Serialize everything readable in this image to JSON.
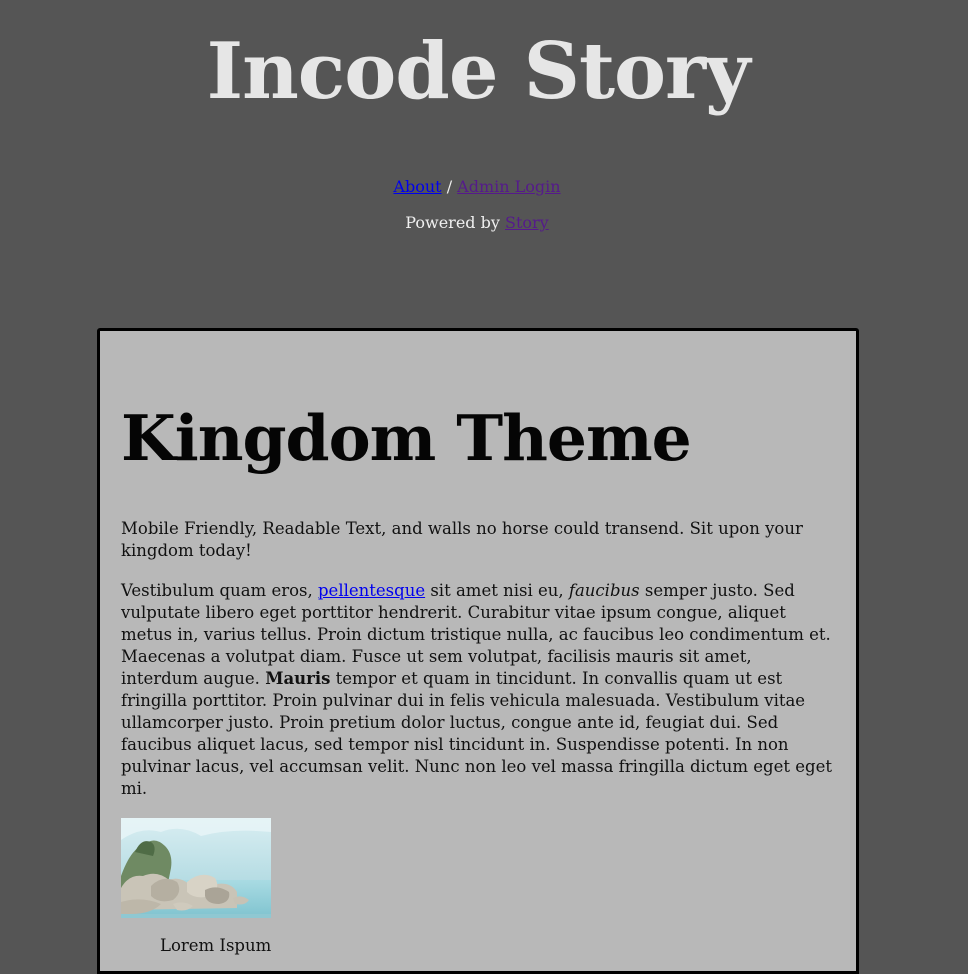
{
  "site": {
    "title": "Incode Story"
  },
  "nav": {
    "about_label": "About",
    "separator": "/",
    "admin_label": "Admin Login"
  },
  "footer": {
    "powered_prefix": "Powered by",
    "powered_link": "Story"
  },
  "post": {
    "title": "Kingdom Theme",
    "intro": "Mobile Friendly, Readable Text, and walls no horse could transend. Sit upon your kingdom today!",
    "body": {
      "part1": "Vestibulum quam eros, ",
      "link": "pellentesque",
      "part2": " sit amet nisi eu, ",
      "italic": "faucibus",
      "part3": " semper justo. Sed vulputate libero eget porttitor hendrerit. Curabitur vitae ipsum congue, aliquet metus in, varius tellus. Proin dictum tristique nulla, ac faucibus leo condimentum et. Maecenas a volutpat diam. Fusce ut sem volutpat, facilisis mauris sit amet, interdum augue. ",
      "bold": "Mauris",
      "part4": " tempor et quam in tincidunt. In convallis quam ut est fringilla porttitor. Proin pulvinar dui in felis vehicula malesuada. Vestibulum vitae ullamcorper justo. Proin pretium dolor luctus, congue ante id, feugiat dui. Sed faucibus aliquet lacus, sed tempor nisl tincidunt in. Suspendisse potenti. In non pulvinar lacus, vel accumsan velit. Nunc non leo vel massa fringilla dictum eget eget mi."
    },
    "caption": "Lorem Ispum"
  },
  "colors": {
    "page_background": "#555555",
    "card_background": "#b8b8b8",
    "title_text": "#e6e6e6",
    "link": "#0000ee",
    "visited_link": "#551a8b"
  },
  "icons": {
    "photo": "rocky-seascape-image"
  }
}
